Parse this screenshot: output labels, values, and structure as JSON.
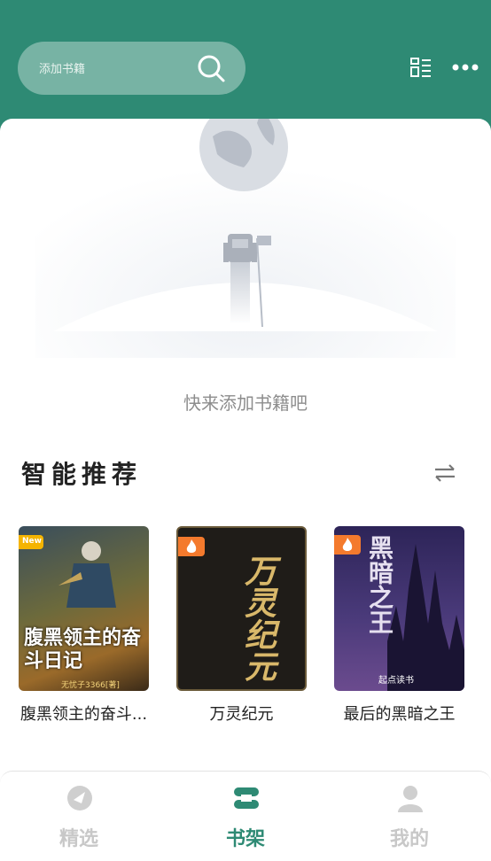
{
  "search": {
    "placeholder": "添加书籍"
  },
  "bookshelf": {
    "empty_text": "快来添加书籍吧"
  },
  "recommend": {
    "title": "智能推荐",
    "books": [
      {
        "title": "腹黑领主的奋斗...",
        "cover_text": "腹黑领主的奋斗日记",
        "badge": "New",
        "author_line": "无忧子3366[著]"
      },
      {
        "title": "万灵纪元",
        "cover_text": "万灵纪元"
      },
      {
        "title": "最后的黑暗之王",
        "cover_text": "黑暗之王",
        "publisher": "起点读书"
      }
    ]
  },
  "tabs": [
    {
      "label": "精选",
      "icon": "compass-icon",
      "active": false
    },
    {
      "label": "书架",
      "icon": "bookshelf-icon",
      "active": true
    },
    {
      "label": "我的",
      "icon": "user-icon",
      "active": false
    }
  ],
  "colors": {
    "brand": "#2e8a74",
    "inactive_tab": "#c8c8c8"
  }
}
